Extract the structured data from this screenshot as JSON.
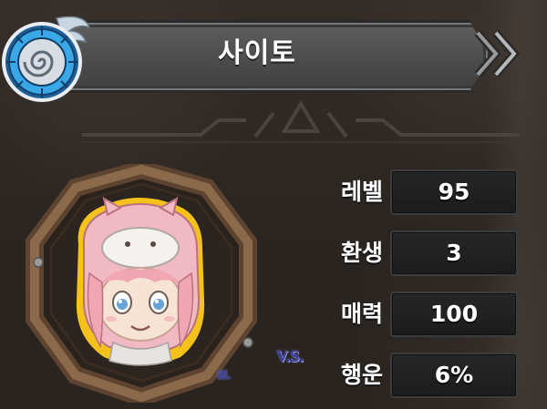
{
  "character": {
    "name": "사이토"
  },
  "stats": [
    {
      "label": "레벨",
      "value": "95"
    },
    {
      "label": "환생",
      "value": "3"
    },
    {
      "label": "매력",
      "value": "100"
    },
    {
      "label": "행운",
      "value": "6%"
    }
  ],
  "vs_label": "V.S.",
  "icons": {
    "emblem": "spiral-wing-emblem-icon",
    "chevrons": "double-chevron-right-icon",
    "portrait": "character-portrait"
  },
  "colors": {
    "background": "#2c2622",
    "banner": "#4c4c4c",
    "emblem_blue": "#3aa7e6",
    "frame_wood": "#7a5a3e",
    "stat_box": "#1e1e1e",
    "vs_text": "#3a3fa0"
  }
}
